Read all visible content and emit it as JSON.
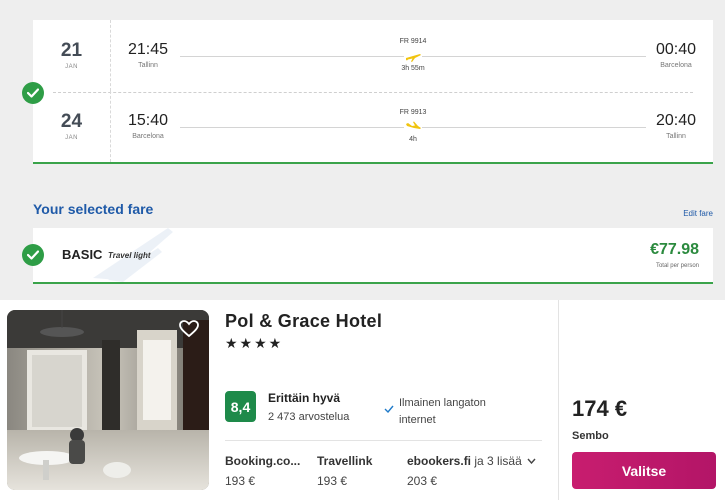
{
  "flights": {
    "outbound": {
      "day": "21",
      "month": "JAN",
      "dep_time": "21:45",
      "dep_city": "Tallinn",
      "flight_no": "FR 9914",
      "duration": "3h 55m",
      "arr_time": "00:40",
      "arr_city": "Barcelona"
    },
    "inbound": {
      "day": "24",
      "month": "JAN",
      "dep_time": "15:40",
      "dep_city": "Barcelona",
      "flight_no": "FR 9913",
      "duration": "4h",
      "arr_time": "20:40",
      "arr_city": "Tallinn"
    }
  },
  "fare": {
    "section_title": "Your selected fare",
    "edit_label": "Edit fare",
    "name": "BASIC",
    "tag": "Travel light",
    "price": "€77.98",
    "price_note": "Total per person"
  },
  "hotel": {
    "name": "Pol & Grace Hotel",
    "stars": "★★★★",
    "rating_score": "8,4",
    "rating_label": "Erittäin hyvä",
    "rating_count": "2 473 arvostelua",
    "amenity": "Ilmainen langaton internet",
    "providers": [
      {
        "name": "Booking.co...",
        "price": "193 €"
      },
      {
        "name": "Travellink",
        "price": "193 €"
      },
      {
        "name": "ebookers.fi",
        "more": "ja 3 lisää",
        "price": "203 €"
      }
    ],
    "best_price": "174 €",
    "best_source": "Sembo",
    "cta_label": "Valitse"
  },
  "colors": {
    "accent_green": "#2e9d46",
    "link_blue": "#1f5aa8",
    "cta_pink": "#c81d6f",
    "plane_yellow": "#f1c40f"
  }
}
